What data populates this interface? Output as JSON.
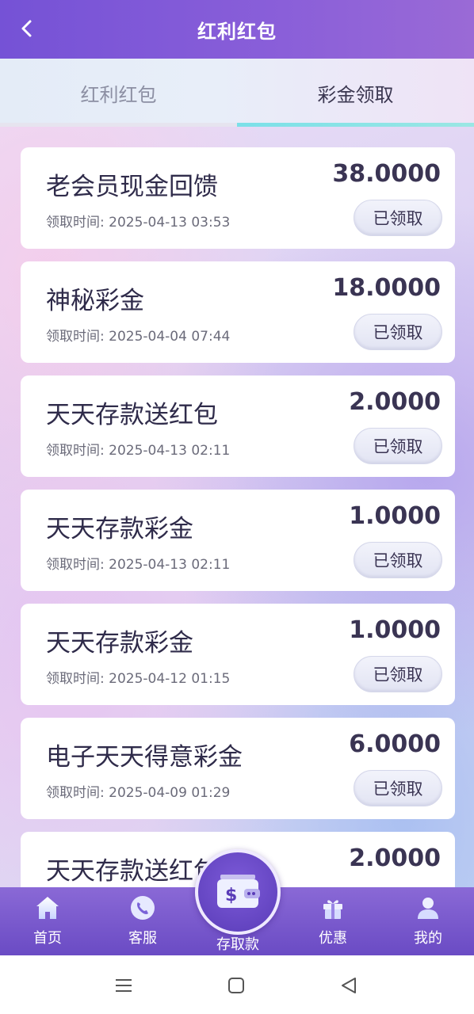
{
  "header": {
    "title": "红利红包"
  },
  "tabs": [
    {
      "label": "红利红包",
      "active": false
    },
    {
      "label": "彩金领取",
      "active": true
    }
  ],
  "records": [
    {
      "name": "老会员现金回馈",
      "time": "领取时间: 2025-04-13 03:53",
      "amount": "38.0000",
      "status": "已领取"
    },
    {
      "name": "神秘彩金",
      "time": "领取时间: 2025-04-04 07:44",
      "amount": "18.0000",
      "status": "已领取"
    },
    {
      "name": "天天存款送红包",
      "time": "领取时间: 2025-04-13 02:11",
      "amount": "2.0000",
      "status": "已领取"
    },
    {
      "name": "天天存款彩金",
      "time": "领取时间: 2025-04-13 02:11",
      "amount": "1.0000",
      "status": "已领取"
    },
    {
      "name": "天天存款彩金",
      "time": "领取时间: 2025-04-12 01:15",
      "amount": "1.0000",
      "status": "已领取"
    },
    {
      "name": "电子天天得意彩金",
      "time": "领取时间: 2025-04-09 01:29",
      "amount": "6.0000",
      "status": "已领取"
    },
    {
      "name": "天天存款送红包",
      "time": "",
      "amount": "2.0000",
      "status": ""
    }
  ],
  "bottom_nav": [
    {
      "label": "首页",
      "icon": "home-icon"
    },
    {
      "label": "客服",
      "icon": "customer-service-icon"
    },
    {
      "label": "存取款",
      "icon": "wallet-icon"
    },
    {
      "label": "优惠",
      "icon": "gift-icon"
    },
    {
      "label": "我的",
      "icon": "user-icon"
    }
  ],
  "system_nav": [
    {
      "icon": "menu-icon"
    },
    {
      "icon": "home-square-icon"
    },
    {
      "icon": "back-triangle-icon"
    }
  ],
  "colors": {
    "header": "#7552d6",
    "nav": "#6a4bc4",
    "tab_indicator": "#7be0e8",
    "text_dark": "#2f2b4a"
  }
}
